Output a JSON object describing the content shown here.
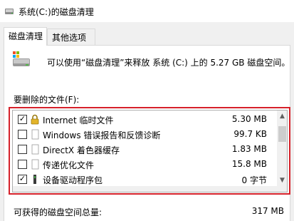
{
  "window": {
    "title": "系统(C:)的磁盘清理"
  },
  "tabs": [
    {
      "label": "磁盘清理",
      "active": true
    },
    {
      "label": "其他选项",
      "active": false
    }
  ],
  "summary": {
    "text": "可以使用“磁盘清理”来释放 系统 (C:) 上的 5.27 GB 磁盘空间。"
  },
  "files_section": {
    "label": "要删除的文件(F):",
    "items": [
      {
        "checked": true,
        "icon": "lock-icon",
        "name": "Internet 临时文件",
        "size": "5.30 MB"
      },
      {
        "checked": false,
        "icon": "blank-file-icon",
        "name": "Windows 错误报告和反馈诊断",
        "size": "99.7 KB"
      },
      {
        "checked": false,
        "icon": "blank-file-icon",
        "name": "DirectX 着色器缓存",
        "size": "1.83 MB"
      },
      {
        "checked": false,
        "icon": "blank-file-icon",
        "name": "传递优化文件",
        "size": "15.8 MB"
      },
      {
        "checked": true,
        "icon": "device-driver-icon",
        "name": "设备驱动程序包",
        "size": "0 字节"
      }
    ]
  },
  "total": {
    "label": "可获得的磁盘空间总量:",
    "value": "317 MB"
  },
  "colors": {
    "highlight_frame": "#d6212a",
    "window_bg": "#f0f0f0",
    "panel_bg": "#ffffff"
  }
}
